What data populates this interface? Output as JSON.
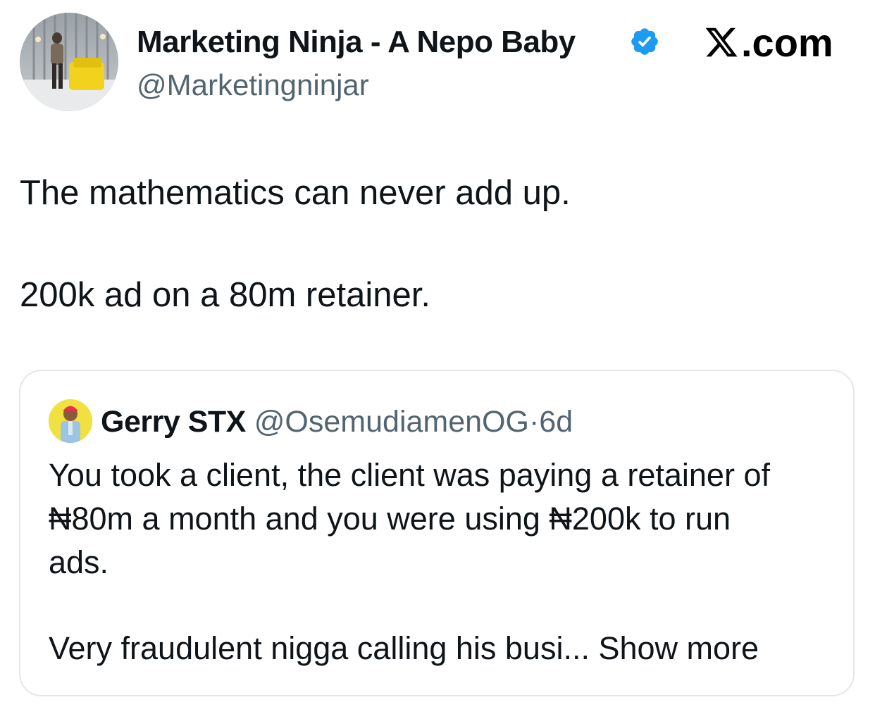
{
  "header": {
    "display_name": "Marketing Ninja - A Nepo Baby",
    "handle": "@Marketingninjar",
    "verified_icon": "verified-badge-icon",
    "site_label": ".com",
    "site_logo_icon": "x-logo-icon"
  },
  "tweet": {
    "line1": "The mathematics can never add up.",
    "line2": "200k ad on a 80m retainer."
  },
  "quoted_tweet": {
    "name": "Gerry STX",
    "handle": "@OsemudiamenOG",
    "separator": "·",
    "time": "6d",
    "line1": "You took a client, the client was paying a retainer of",
    "line2": "₦80m a month and you were using ₦200k to run",
    "line3": "ads.",
    "line4": "Very fraudulent nigga calling his busi...",
    "show_more": "Show more"
  },
  "colors": {
    "text_primary": "#0f1419",
    "text_secondary": "#536471",
    "verified_blue": "#1d9bf0",
    "card_border": "#e3e7ea"
  }
}
